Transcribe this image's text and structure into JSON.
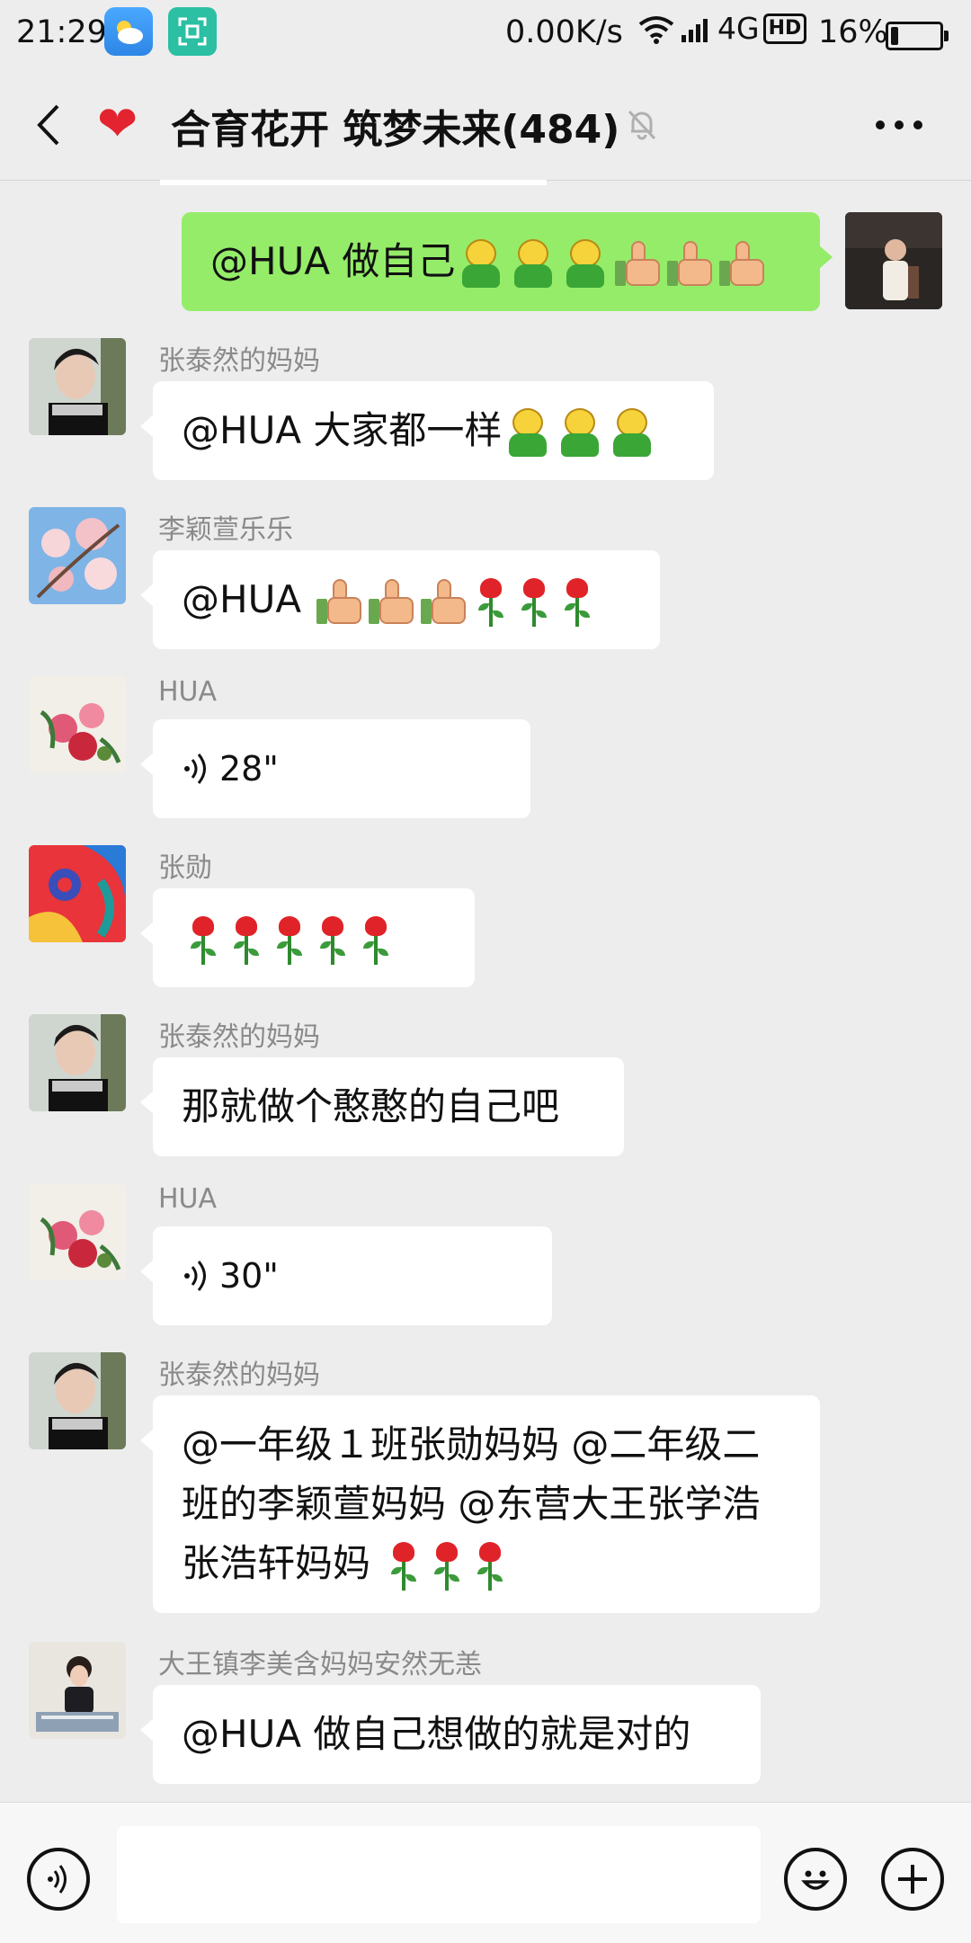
{
  "status_bar": {
    "time": "21:29",
    "net_speed": "0.00K/s",
    "network": "4G",
    "hd": "HD",
    "battery_text": "16%",
    "battery_level": 0.16
  },
  "header": {
    "title": "合育花开 筑梦未来(484)"
  },
  "messages": [
    {
      "type": "text",
      "mine": true,
      "text": "@HUA  做自己",
      "emojis": [
        "doll",
        "doll",
        "doll",
        "thumb",
        "thumb",
        "thumb"
      ]
    },
    {
      "type": "text",
      "sender": "张泰然的妈妈",
      "text": "@HUA  大家都一样",
      "emojis": [
        "doll",
        "doll",
        "doll"
      ]
    },
    {
      "type": "text",
      "sender": "李颖萱乐乐",
      "text": "@HUA ",
      "emojis": [
        "thumb",
        "thumb",
        "thumb",
        "rose",
        "rose",
        "rose"
      ]
    },
    {
      "type": "voice",
      "sender": "HUA",
      "duration": "28\""
    },
    {
      "type": "text",
      "sender": "张勋",
      "text": "",
      "emojis": [
        "rose",
        "rose",
        "rose",
        "rose",
        "rose"
      ]
    },
    {
      "type": "text",
      "sender": "张泰然的妈妈",
      "text": "那就做个憨憨的自己吧",
      "emojis": []
    },
    {
      "type": "voice",
      "sender": "HUA",
      "duration": "30\""
    },
    {
      "type": "text",
      "sender": "张泰然的妈妈",
      "text": "@一年级１班张勋妈妈 @二年级二班的李颖萱妈妈 @东营大王张学浩张浩轩妈妈 ",
      "emojis": [
        "rose",
        "rose",
        "rose"
      ]
    },
    {
      "type": "text",
      "sender": "大王镇李美含妈妈安然无恙",
      "text": "@HUA  做自己想做的就是对的",
      "emojis": []
    }
  ],
  "input": {
    "placeholder": ""
  },
  "colors": {
    "background": "#ededed",
    "my_bubble": "#95ec69",
    "heart": "#e3232f"
  }
}
